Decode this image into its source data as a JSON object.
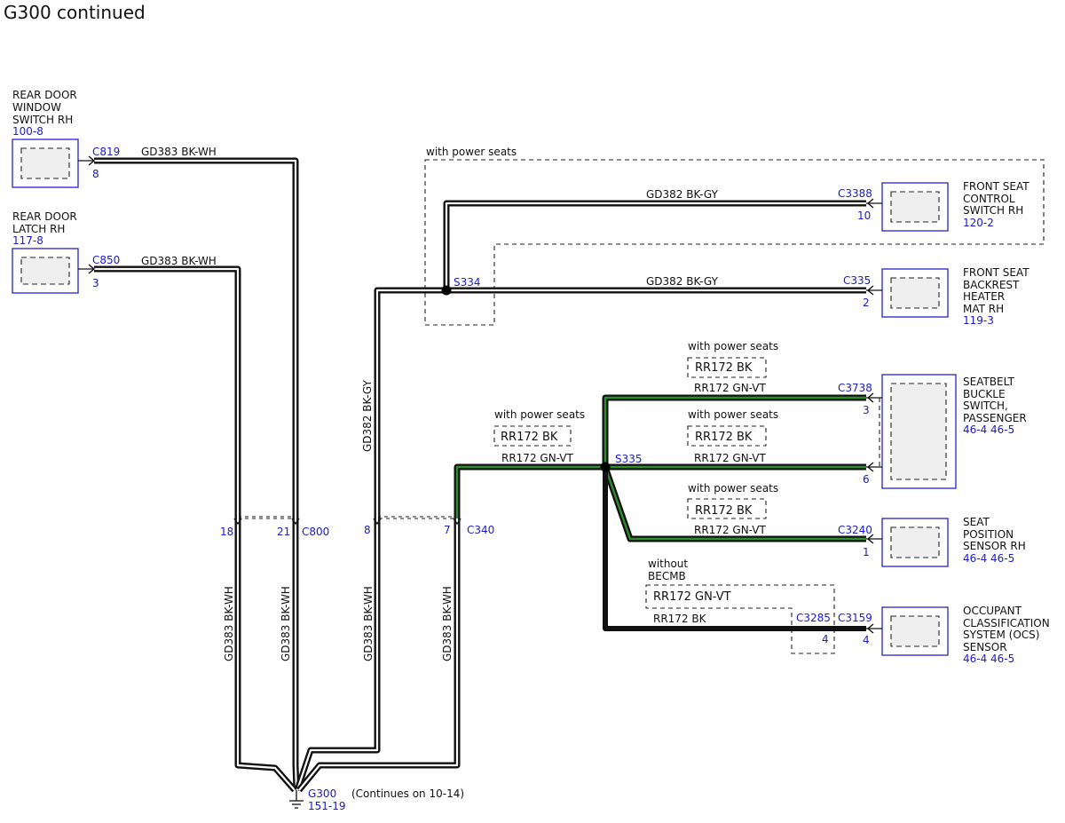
{
  "title": "G300 continued",
  "components": {
    "rear_door_window_switch": {
      "name": [
        "REAR DOOR",
        "WINDOW",
        "SWITCH RH"
      ],
      "ref": "100-8",
      "connector": "C819",
      "pin": "8"
    },
    "rear_door_latch": {
      "name": [
        "REAR DOOR",
        "LATCH RH"
      ],
      "ref": "117-8",
      "connector": "C850",
      "pin": "3"
    },
    "front_seat_control_switch": {
      "name": [
        "FRONT SEAT",
        "CONTROL",
        "SWITCH RH"
      ],
      "ref": "120-2",
      "connector": "C3388",
      "pin": "10"
    },
    "front_seat_backrest_heater": {
      "name": [
        "FRONT SEAT",
        "BACKREST",
        "HEATER",
        "MAT RH"
      ],
      "ref": "119-3",
      "connector": "C335",
      "pin": "2"
    },
    "seatbelt_buckle_switch": {
      "name": [
        "SEATBELT",
        "BUCKLE",
        "SWITCH,",
        "PASSENGER"
      ],
      "ref": "46-4  46-5",
      "connector": "C3738",
      "pin_top": "3",
      "pin_bottom": "6"
    },
    "seat_position_sensor": {
      "name": [
        "SEAT",
        "POSITION",
        "SENSOR RH"
      ],
      "ref": "46-4  46-5",
      "connector": "C3240",
      "pin": "1"
    },
    "ocs_sensor": {
      "name": [
        "OCCUPANT",
        "CLASSIFICATION",
        "SYSTEM (OCS)",
        "SENSOR"
      ],
      "ref": "46-4  46-5",
      "connector": "C3159",
      "pin": "4"
    }
  },
  "wires": {
    "gd383_bkwh": "GD383  BK-WH",
    "gd382_bkgy": "GD382  BK-GY",
    "rr172_gnvt": "RR172  GN-VT",
    "rr172_bk": "RR172  BK"
  },
  "options": {
    "with_power_seats": "with power seats",
    "without_becmb": [
      "without",
      "BECMB"
    ]
  },
  "splices": {
    "s334": "S334",
    "s335": "S335"
  },
  "inline_connectors": {
    "c800": {
      "name": "C800",
      "pins": [
        "18",
        "21"
      ]
    },
    "c340": {
      "name": "C340",
      "pins": [
        "8",
        "7"
      ]
    },
    "c3285": {
      "name": "C3285",
      "pin": "4"
    }
  },
  "ground": {
    "name": "G300",
    "ref": "151-19",
    "note": "(Continues on 10-14)"
  }
}
